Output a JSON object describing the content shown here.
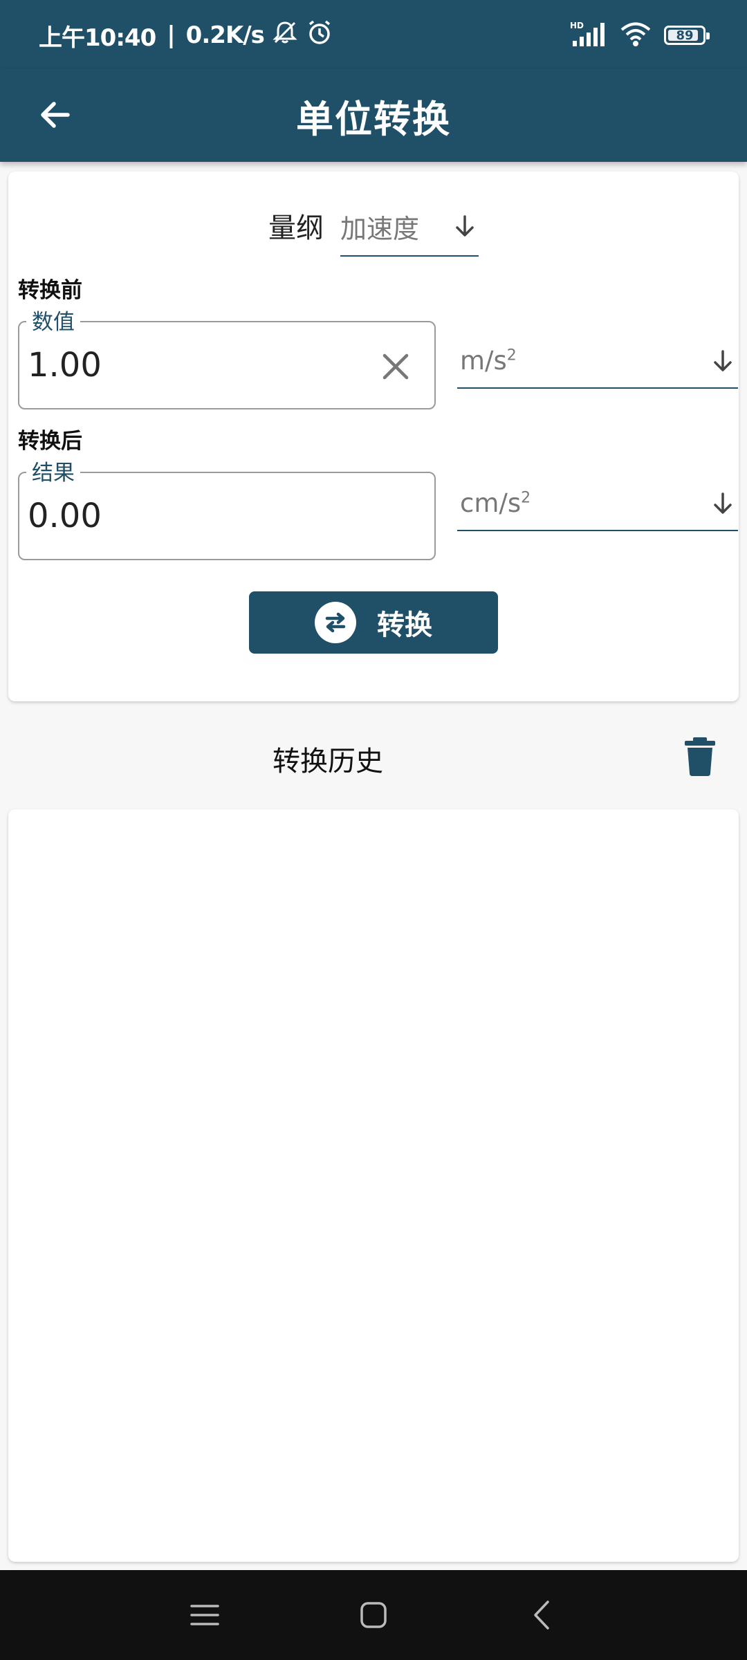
{
  "status_bar": {
    "time": "上午10:40",
    "network_speed": "0.2K/s",
    "battery": "89",
    "battery_level": 0.89,
    "icons": [
      "mute-icon",
      "alarm-icon",
      "hd-signal-icon",
      "wifi-icon",
      "battery-icon"
    ]
  },
  "app_bar": {
    "title": "单位转换",
    "back_icon": "arrow-left-icon"
  },
  "converter": {
    "dimension_label": "量纲",
    "dimension_value": "加速度",
    "before": {
      "section_label": "转换前",
      "field_legend": "数值",
      "field_value": "1.00",
      "unit_base": "m/s",
      "unit_exp": "2"
    },
    "after": {
      "section_label": "转换后",
      "field_legend": "结果",
      "field_value": "0.00",
      "unit_base": "cm/s",
      "unit_exp": "2"
    },
    "convert_button": "转换"
  },
  "history": {
    "title": "转换历史",
    "items": []
  },
  "colors": {
    "primary": "#1f5068",
    "background": "#f7f7f7",
    "nav_bar": "#111111"
  }
}
